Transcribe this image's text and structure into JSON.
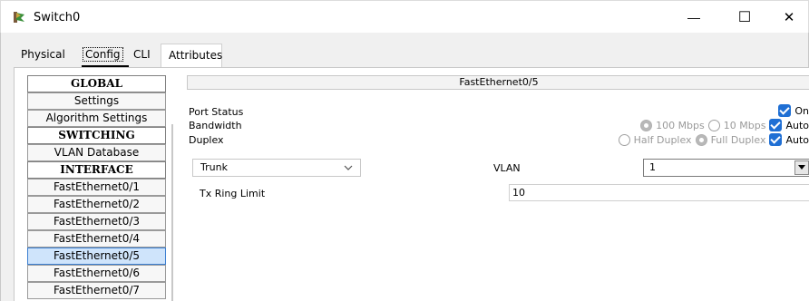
{
  "window": {
    "title": "Switch0",
    "minimize_glyph": "—",
    "maximize_glyph": "☐",
    "close_glyph": "✕"
  },
  "tabs": [
    {
      "label": "Physical"
    },
    {
      "label": "Config"
    },
    {
      "label": "CLI"
    },
    {
      "label": "Attributes"
    }
  ],
  "sidebar": {
    "items": [
      {
        "label": "GLOBAL",
        "type": "header"
      },
      {
        "label": "Settings"
      },
      {
        "label": "Algorithm Settings"
      },
      {
        "label": "SWITCHING",
        "type": "header"
      },
      {
        "label": "VLAN Database"
      },
      {
        "label": "INTERFACE",
        "type": "header"
      },
      {
        "label": "FastEthernet0/1"
      },
      {
        "label": "FastEthernet0/2"
      },
      {
        "label": "FastEthernet0/3"
      },
      {
        "label": "FastEthernet0/4"
      },
      {
        "label": "FastEthernet0/5",
        "selected": true
      },
      {
        "label": "FastEthernet0/6"
      },
      {
        "label": "FastEthernet0/7"
      }
    ]
  },
  "interface": {
    "title": "FastEthernet0/5",
    "port_status": {
      "label": "Port Status",
      "on_label": "On",
      "on": true
    },
    "bandwidth": {
      "label": "Bandwidth",
      "opt100": "100 Mbps",
      "opt10": "10 Mbps",
      "auto_label": "Auto",
      "auto": true
    },
    "duplex": {
      "label": "Duplex",
      "half": "Half Duplex",
      "full": "Full Duplex",
      "auto_label": "Auto",
      "auto": true
    },
    "mode": {
      "value": "Trunk"
    },
    "vlan": {
      "label": "VLAN",
      "value": "1"
    },
    "tx_ring": {
      "label": "Tx Ring Limit",
      "value": "10"
    }
  }
}
